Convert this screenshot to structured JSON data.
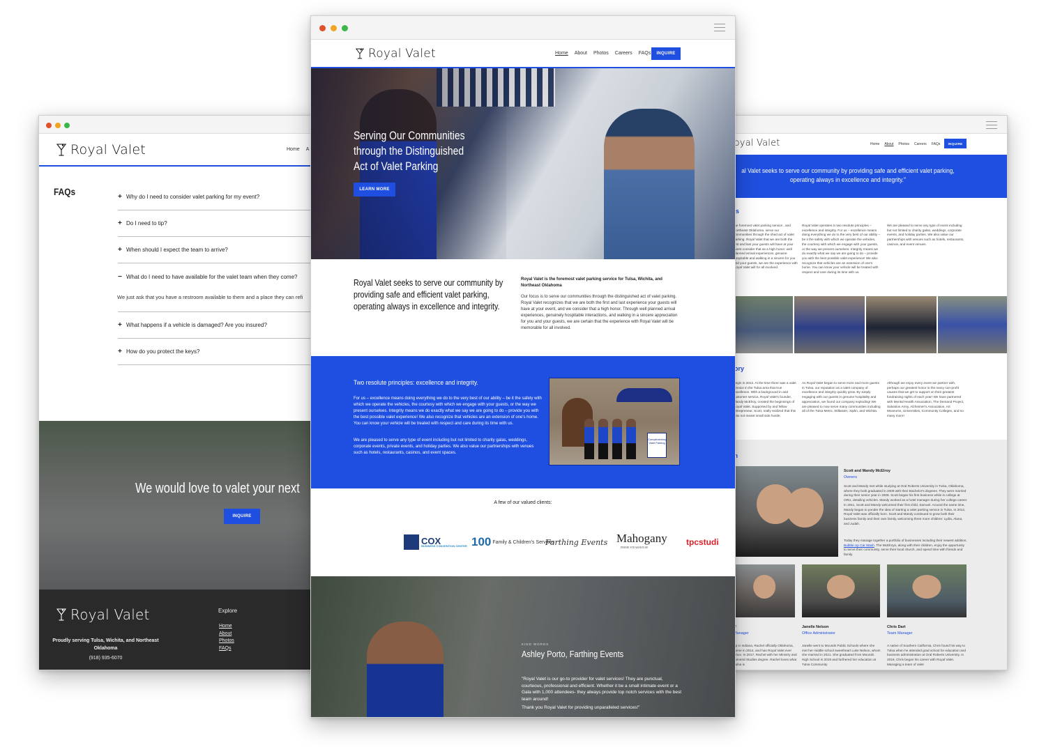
{
  "brand": {
    "name": "Royal Valet",
    "accent": "#1f4fe0",
    "footer_bg": "#2a2a2a"
  },
  "left_window": {
    "nav": [
      "Home",
      "A"
    ],
    "faq_title": "FAQs",
    "faqs": [
      {
        "q": "Why do I need to consider valet parking for my event?",
        "open": false
      },
      {
        "q": "Do I need to tip?",
        "open": false
      },
      {
        "q": "When should I expect the team to arrive?",
        "open": false
      },
      {
        "q": "What do I need to have available for the valet team when they come?",
        "open": true,
        "a": "We just ask that you have a restroom available to them and a place they can refi"
      },
      {
        "q": "What happens if a vehicle is damaged? Are you insured?",
        "open": false
      },
      {
        "q": "How do you protect the keys?",
        "open": false
      }
    ],
    "hero_text": "We would love to valet your next",
    "hero_button": "INQUIRE",
    "footer": {
      "tagline": "Proudly serving Tulsa, Wichita, and Northeast Oklahoma",
      "phone": "(918) 935-6070",
      "explore_title": "Explore",
      "explore_links": [
        "Home",
        "About",
        "Photos",
        "FAQs"
      ]
    }
  },
  "center_window": {
    "nav": [
      "Home",
      "About",
      "Photos",
      "Careers",
      "FAQs"
    ],
    "nav_active": "Home",
    "inquire": "INQUIRE",
    "hero": {
      "lines": [
        "Serving Our Communities",
        "through the Distinguished",
        "Act of Valet Parking"
      ],
      "button": "LEARN MORE"
    },
    "intro": {
      "lead": "Royal Valet seeks to serve our community by providing safe and efficient valet parking, operating always in excellence and integrity.",
      "bold": "Royal Valet is the foremost valet parking service for Tulsa, Wichita, and Northeast Oklahoma",
      "body": "Our focus is to serve our communities through the distinguished act of valet parking. Royal Valet recognizes that we are both the first and last experience your guests will have at your event, and we consider that a high honor. Through well planned arrival experiences, genuinely hospitable interactions, and walking in a sincere appreciation for you and your guests, we are certain that the experience with Royal Valet will be memorable for all involved."
    },
    "principles": {
      "title": "Two resolute principles: excellence and integrity.",
      "p1": "For us – excellence means doing everything we do to the very best of our ability – be it the safety with which we operate the vehicles, the courtesy with which we engage with your guests, or the way we present ourselves.  Integrity means we do exactly what we say we are going to do – provide you with the best possible valet experience!  We also recognize that vehicles are an extension of one's home.  You can know your vehicle will be treated with respect and care during its time with us.",
      "p2": "We are pleased to serve any type of event including but not limited to charity galas, weddings, corporate events, private events, and holiday parties.  We also value our partnerships with venues such as hotels, restaurants, casinos, and event spaces.",
      "photo_sign": "Complimentary Valet Parking"
    },
    "clients": {
      "title": "A few of our valued clients:",
      "logos": [
        {
          "name": "COX",
          "sub": "BUSINESS CONVENTION CENTER"
        },
        {
          "name": "100",
          "sub": "Family & Children's Services"
        },
        {
          "name": "Farthing Events"
        },
        {
          "name": "Mahogany",
          "sub": "PRIME STEAKHOUSE"
        },
        {
          "name": "tpcstudi"
        }
      ]
    },
    "testimonial": {
      "kicker": "KIND WORDS",
      "name": "Ashley Porto, Farthing Events",
      "quote": "\"Royal Valet is our go-to provider for valet services! They are punctual, courteous, professional and efficient. Whether it be a small intimate event or a Gala with 1,000 attendees- they always provide top notch services with the best team around!",
      "thanks": "Thank you Royal Valet for providing unparalleled services!\""
    }
  },
  "right_window": {
    "nav": [
      "Home",
      "About",
      "Photos",
      "Careers",
      "FAQs"
    ],
    "nav_active": "About",
    "inquire": "INQUIRE",
    "banner": "al Valet seeks to serve our community by providing safe and efficient valet parking, operating always in excellence and integrity.\"",
    "section1_heading": "Js",
    "section1_cols": [
      "the foremost valet parking service , and Northeast Oklahoma. serve our communities through the shed act of valet parking. Royal Valet that we are both the first and last your guests will have at your event consider that as a high honor. well planned arrival experiences, genuine hospitable and walking in a sincere for you and your guests, we are the experience with Royal Valet will for all involved.",
      "Royal Valet operates in two resolute principles – excellence and integrity.  For us – excellence means doing everything we do to the very best of our ability – be it the safety with which we operate the vehicles, the courtesy with which we engage with your guests, or the way we present ourselves.  Integrity means we do exactly what we say we are going to do – provide you with the best possible valet experience!  We also recognize that vehicles are an extension of one's home.  You can know your vehicle will be treated with respect and care during its time with us.",
      "We are pleased to serve any type of event including but not limited to charity galas, weddings, corporate events, and holiday parties. We also value our partnerships with venues such as hotels, restaurants, casinos, and event venues."
    ],
    "section2_heading": "tory",
    "section2_cols": [
      "begin in 2012. At the time there was a valet service in the Tulsa area that true excellence. With a background in and customer service, Royal Valet's founder, Mandy McElroy, created the beginnings of Royal Valet. Supported by and fellow entrepreneur, Scott, really realized that this was not meant small side hustle.",
      "As Royal Valet began to serve more and more guests in Tulsa, our reputation as a valet company of excellence and integrity quickly grew. By simply engaging with our guests in genuine hospitality and appreciation, we found our company exploding! We are pleased to now serve many communities including all of the Tulsa Metro, Stillwater, Joplin, and Wichita.",
      "Although we enjoy every event we partner with, perhaps our greatest honor is the many non-profit causes that we get to support on their greatest fundraising nights of each year! We have partnered with Mental Health Association, The Demand Project, Salvation Army, Alzheimer's Association, Art Museums, Universities, Community Colleges, and so many more!"
    ],
    "team_heading": "m",
    "owners": {
      "name": "Scott and Mandy McElroy",
      "role": "Owners",
      "bio": "Scott and Mandy met while studying at Oral Roberts University in Tulsa, Oklahoma, where they both graduated in 2009 with their Bachelor's degrees. They were married during their senior year in 2008. Scott began his first business while in college at ORU, detailing vehicles. Mandy worked as a hotel manager during her college career. In 2011, Scott and Mandy welcomed their first child, Samuel. Around the same time, Mandy began to ponder the idea of starting a valet parking service in Tulsa. In 2012, Royal Valet was officially born. Scott and Mandy continued to grow both their business family and their own family, welcoming three more children: Lydia, Alana, and Judah.",
      "bio2_pre": "Today they manage together a portfolio of businesses including their newest addition, ",
      "bio2_link": "Bubble Up Car Wash",
      "bio2_post": ". The McElroys, along with their children, enjoy the opportunity to serve their community, serve their local church, and spend time with friends and family."
    },
    "staff": [
      {
        "name": "ff",
        "role": "Manager",
        "bio": "up in Indiana, Rachel officially Oklahoma, home in 2014, and has Royal Valet ever since. In 2017, Rachel with her Ministry and General Studies degree. Rachel loves what Tulsa is"
      },
      {
        "name": "Janelle Nelson",
        "role": "Office Administrator",
        "bio": "Janelle went to Mounds Public Schools where she met her middle school sweetheart Luke Nelson, whom she married in 2021. She graduated from Mounds High School in 2019 and furthered her education at Tulsa Community"
      },
      {
        "name": "Chris Dart",
        "role": "Team Manager",
        "bio": "A native of Southern California, Chris found his way to Tulsa when he attended grad school for education and business administration at Oral Roberts University.  In 2019, Chris began his career with Royal Valet. Managing a team of valet"
      }
    ]
  }
}
